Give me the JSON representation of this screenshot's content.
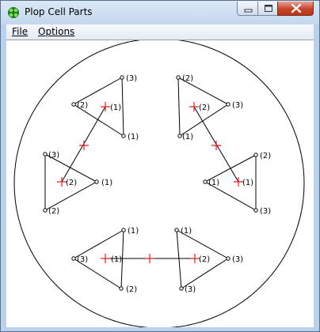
{
  "window": {
    "title": "Plop Cell Parts"
  },
  "menu": {
    "file": "File",
    "options": "Options"
  },
  "colors": {
    "marker": "#dd2222",
    "line": "#000000"
  },
  "canvas": {
    "labels": {
      "v1": "(3)",
      "v2": "(2)",
      "v3": "(1)",
      "v4": "(1)",
      "v5": "(2)",
      "v6": "(3)",
      "v7": "(2)",
      "v8": "(1)",
      "v9": "(3)",
      "v10": "(1)",
      "v11": "(2)",
      "v12": "(2)",
      "v13": "(1)",
      "v14": "(1)",
      "v15": "(3)",
      "v16": "(1)",
      "v17": "(2)",
      "v18": "(3)",
      "v19": "(1)",
      "v20": "(3)",
      "v21": "(2)",
      "v22": "(1)",
      "v23": "(2)",
      "v24": "(3)"
    }
  }
}
